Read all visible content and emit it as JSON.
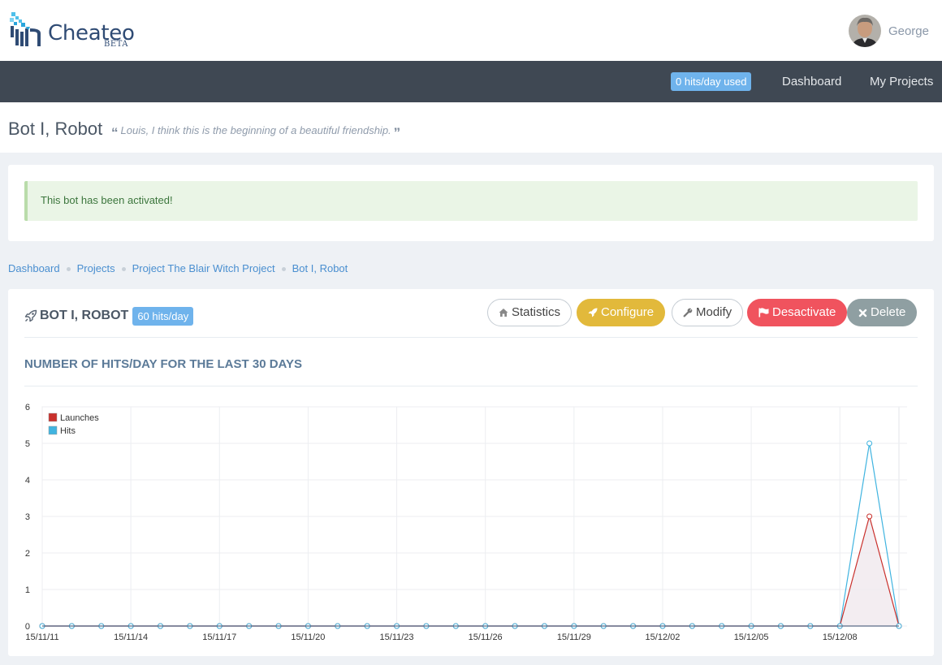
{
  "app": {
    "name": "Cheateo",
    "badge": "BETA"
  },
  "user": {
    "name": "George"
  },
  "nav": {
    "hits_used": "0 hits/day used",
    "dashboard": "Dashboard",
    "my_projects": "My Projects"
  },
  "page": {
    "title": "Bot I, Robot",
    "quote": "Louis, I think this is the beginning of a beautiful friendship."
  },
  "alert": {
    "message": "This bot has been activated!"
  },
  "breadcrumb": [
    "Dashboard",
    "Projects",
    "Project The Blair Witch Project",
    "Bot I, Robot"
  ],
  "card": {
    "title": "BOT I, ROBOT",
    "rate": "60 hits/day",
    "buttons": {
      "statistics": "Statistics",
      "configure": "Configure",
      "modify": "Modify",
      "deactivate": "Desactivate",
      "delete": "Delete"
    },
    "chart_heading": "NUMBER OF HITS/DAY FOR THE LAST 30 DAYS"
  },
  "colors": {
    "launches": "#c9302c",
    "hits": "#40b4e0",
    "configure": "#e2b93b",
    "deactivate": "#f0535e",
    "delete": "#8f9fa2",
    "nav_bg": "#3f4853"
  },
  "chart_data": {
    "type": "line",
    "x": [
      "15/11/11",
      "15/11/12",
      "15/11/13",
      "15/11/14",
      "15/11/15",
      "15/11/16",
      "15/11/17",
      "15/11/18",
      "15/11/19",
      "15/11/20",
      "15/11/21",
      "15/11/22",
      "15/11/23",
      "15/11/24",
      "15/11/25",
      "15/11/26",
      "15/11/27",
      "15/11/28",
      "15/11/29",
      "15/11/30",
      "15/12/01",
      "15/12/02",
      "15/12/03",
      "15/12/04",
      "15/12/05",
      "15/12/06",
      "15/12/07",
      "15/12/08",
      "15/12/09",
      "15/12/10"
    ],
    "x_tick_labels": [
      "15/11/11",
      "15/11/14",
      "15/11/17",
      "15/11/20",
      "15/11/23",
      "15/11/26",
      "15/11/29",
      "15/12/02",
      "15/12/05",
      "15/12/08"
    ],
    "y_ticks": [
      0,
      1,
      2,
      3,
      4,
      5,
      6
    ],
    "ylim": [
      0,
      6
    ],
    "series": [
      {
        "name": "Launches",
        "values": [
          0,
          0,
          0,
          0,
          0,
          0,
          0,
          0,
          0,
          0,
          0,
          0,
          0,
          0,
          0,
          0,
          0,
          0,
          0,
          0,
          0,
          0,
          0,
          0,
          0,
          0,
          0,
          0,
          3,
          0
        ]
      },
      {
        "name": "Hits",
        "values": [
          0,
          0,
          0,
          0,
          0,
          0,
          0,
          0,
          0,
          0,
          0,
          0,
          0,
          0,
          0,
          0,
          0,
          0,
          0,
          0,
          0,
          0,
          0,
          0,
          0,
          0,
          0,
          0,
          5,
          0
        ]
      }
    ],
    "legend_position": "top-left",
    "grid": true
  }
}
